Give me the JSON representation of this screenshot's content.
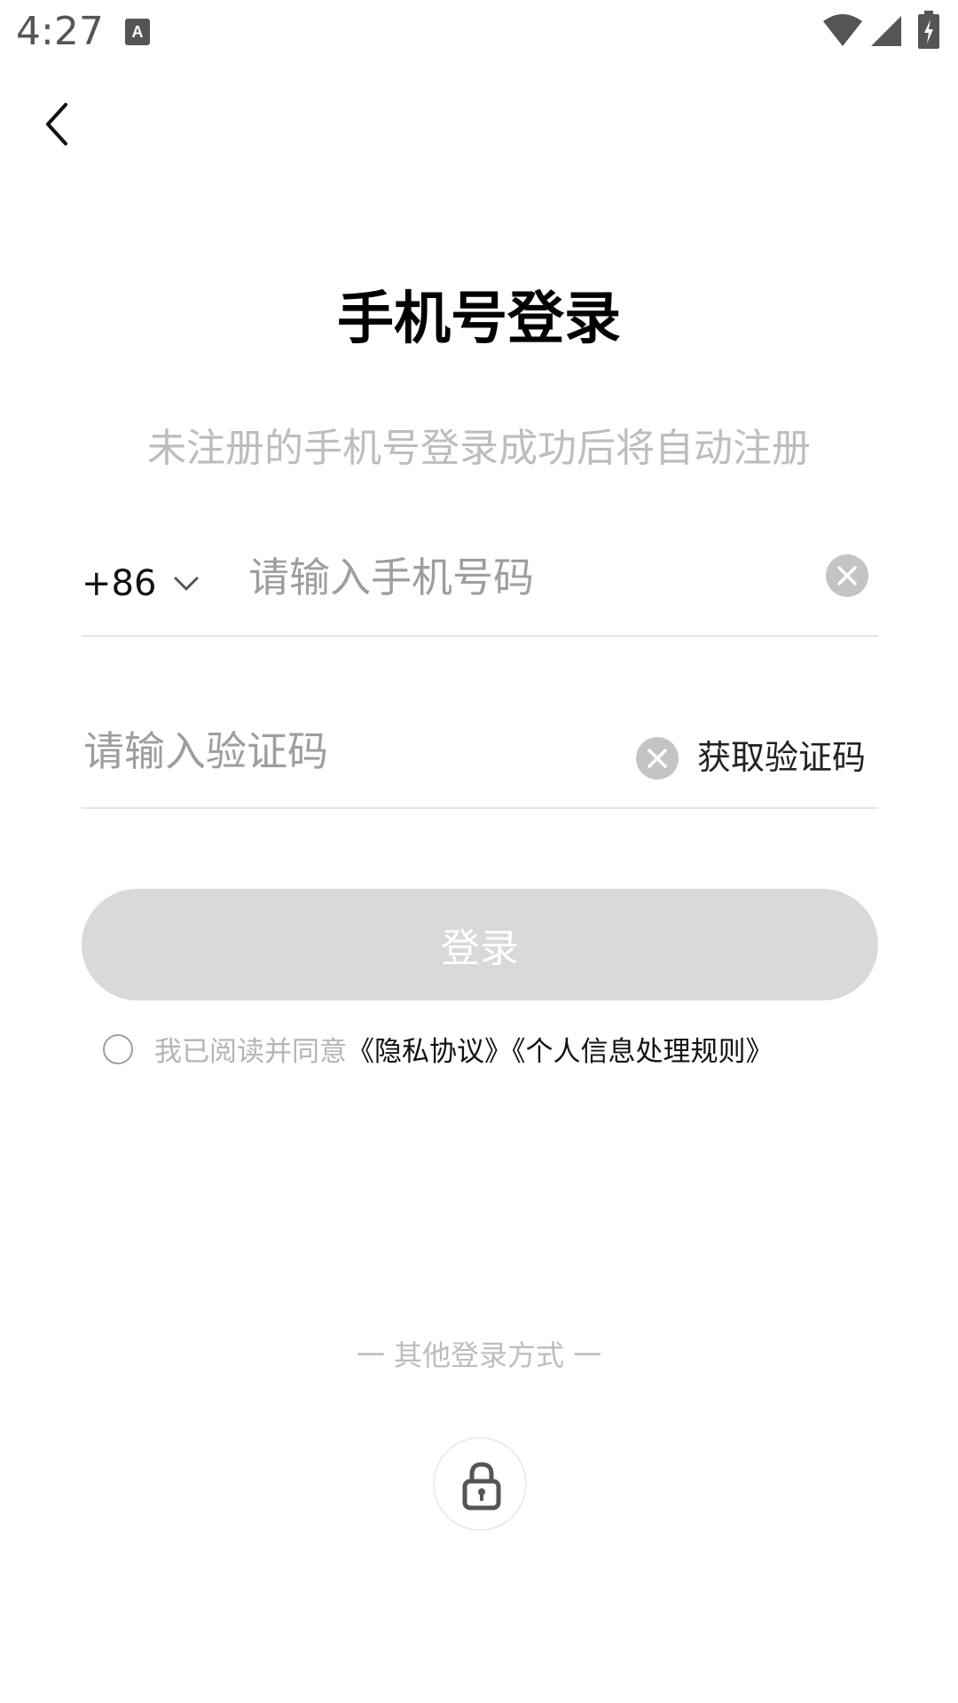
{
  "status_bar": {
    "time": "4:27",
    "icons": [
      "text-input-icon",
      "wifi-icon",
      "signal-icon",
      "battery-charging-icon"
    ]
  },
  "header": {
    "back_icon": "chevron-left-icon"
  },
  "title": "手机号登录",
  "subtitle": "未注册的手机号登录成功后将自动注册",
  "phone": {
    "country_code": "+86",
    "placeholder": "请输入手机号码",
    "value": ""
  },
  "code": {
    "placeholder": "请输入验证码",
    "value": "",
    "get_code_label": "获取验证码"
  },
  "login_button": "登录",
  "agreement": {
    "prefix": "我已阅读并同意",
    "privacy": "《隐私协议》",
    "personal_info": "《个人信息处理规则》"
  },
  "other_login": {
    "label": "一 其他登录方式 一",
    "options": [
      "lock-icon"
    ]
  },
  "colors": {
    "disabled_button": "#d9d9d9",
    "muted_text": "#bdbdbd",
    "divider": "#e6e6e6"
  }
}
